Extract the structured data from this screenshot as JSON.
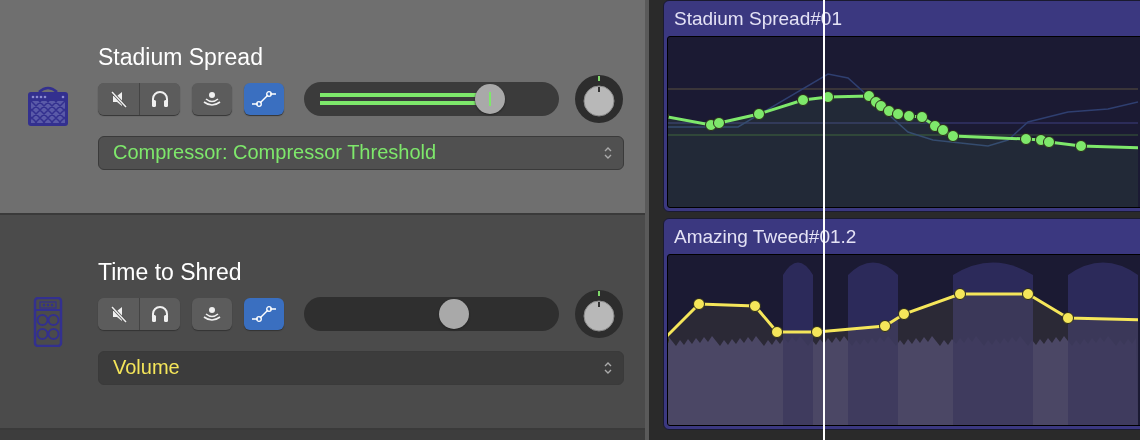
{
  "tracks": [
    {
      "name": "Stadium Spread",
      "selected": true,
      "muted": false,
      "solo": false,
      "input_monitoring": false,
      "automation_shown": true,
      "volume": {
        "level": 0.73,
        "automated": true
      },
      "automation_parameter": "Compressor: Compressor Threshold",
      "color": "#7ee86b"
    },
    {
      "name": "Time to Shred",
      "selected": false,
      "muted": false,
      "solo": false,
      "input_monitoring": false,
      "automation_shown": true,
      "volume": {
        "level": 0.59,
        "automated": false
      },
      "automation_parameter": "Volume",
      "color": "#f5e65a"
    }
  ],
  "regions": [
    {
      "title": "Stadium Spread#01",
      "kind": "graph"
    },
    {
      "title": "Amazing Tweed#01.2",
      "kind": "waveform"
    }
  ]
}
